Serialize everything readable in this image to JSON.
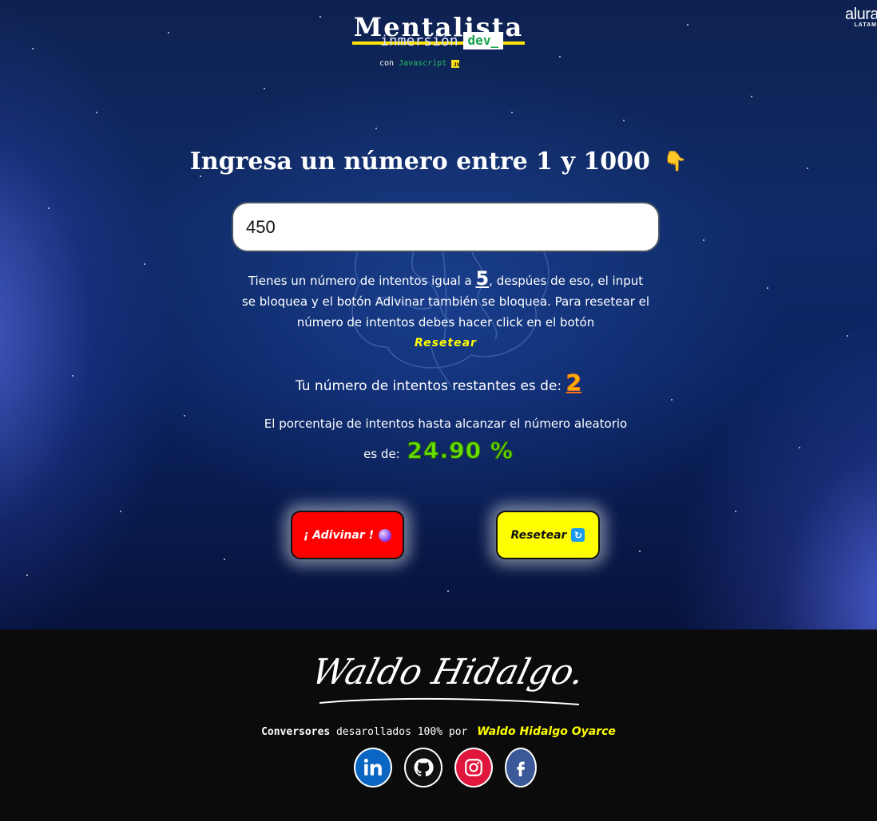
{
  "brand": {
    "title": "Mentalista",
    "subtitle": "inmersión",
    "subtitle_tag": "dev_",
    "tech_prefix": "con",
    "tech": "Javascript",
    "alura_line1": "alura",
    "alura_line2": "LATAM"
  },
  "main": {
    "heading": "Ingresa un número entre 1 y 1000",
    "input_value": "450",
    "info_part1": "Tienes un número de intentos igual a",
    "attempts_total": "5",
    "info_part2": ", despúes de eso, el input se bloquea y el botón Adivinar también se bloquea. Para resetear el número de intentos debes hacer click en el botón",
    "info_reset_word": "Resetear",
    "remaining_label": "Tu número de intentos restantes es de:",
    "remaining_value": "2",
    "percent_label_line1": "El porcentaje de intentos hasta alcanzar el número aleatorio",
    "percent_label_line2": "es de:",
    "percent_value": "24.90 %"
  },
  "buttons": {
    "guess_label": "¡ Adivinar !",
    "reset_label": "Resetear"
  },
  "footer": {
    "signature_text": "Waldo Hidalgo.",
    "credits_bold": "Conversores",
    "credits_text": "desarollados 100% por",
    "credits_author": "Waldo Hidalgo Oyarce",
    "social": [
      "linkedin-icon",
      "github-icon",
      "instagram-icon",
      "facebook-icon"
    ]
  },
  "colors": {
    "accent_yellow": "#ffff00",
    "guess_button": "#ff0000",
    "percent_green": "#66e000",
    "remaining_orange": "#ffb300"
  }
}
